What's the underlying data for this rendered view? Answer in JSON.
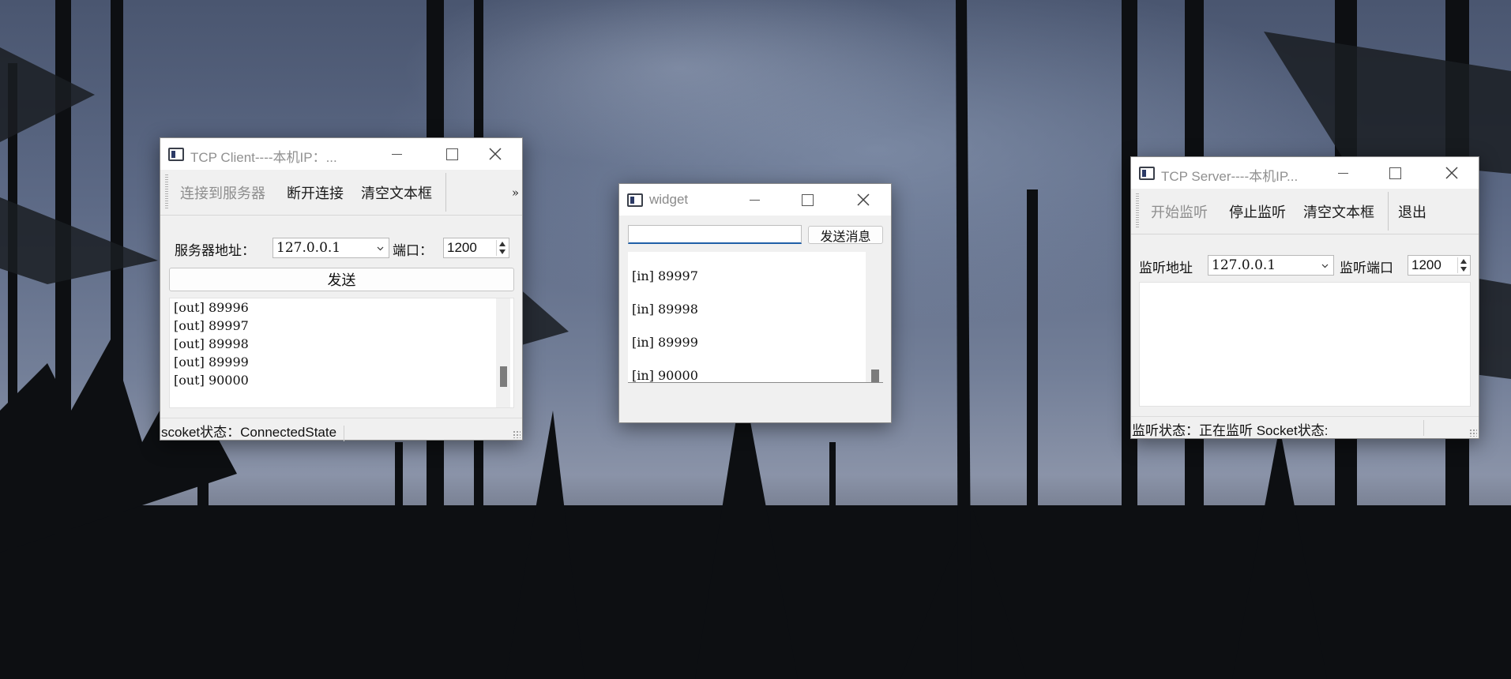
{
  "desktop": {
    "wallpaper": "night-sky-forest"
  },
  "client": {
    "title": "TCP Client----本机IP：...",
    "toolbar": {
      "connect": "连接到服务器",
      "disconnect": "断开连接",
      "clear": "清空文本框",
      "overflow": "»"
    },
    "server_address_label": "服务器地址：",
    "server_address": "127.0.0.1",
    "port_label": "端口：",
    "port": "1200",
    "send_button": "发送",
    "log": [
      "[out] 89996",
      "[out] 89997",
      "[out] 89998",
      "[out] 89999",
      "[out] 90000"
    ],
    "status": "scoket状态：ConnectedState"
  },
  "widget": {
    "title": "widget",
    "message_input": "",
    "send_button": "发送消息",
    "log": [
      "[in] 89997",
      "[in] 89998",
      "[in] 89999",
      "[in] 90000"
    ]
  },
  "server": {
    "title": "TCP Server----本机IP...",
    "toolbar": {
      "start": "开始监听",
      "stop": "停止监听",
      "clear": "清空文本框",
      "exit": "退出"
    },
    "listen_address_label": "监听地址",
    "listen_address": "127.0.0.1",
    "listen_port_label": "监听端口",
    "listen_port": "1200",
    "log": [],
    "status": "监听状态：正在监听 Socket状态:"
  },
  "colors": {
    "accent": "#1f5fa8",
    "disabled_text": "#8e8e8e"
  }
}
